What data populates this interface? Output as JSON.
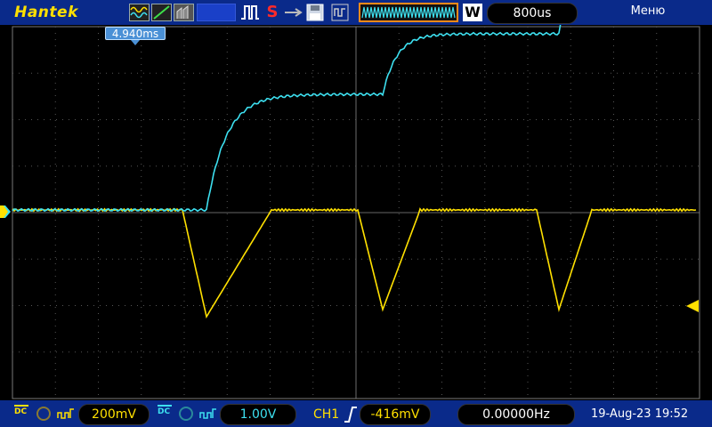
{
  "header": {
    "brand": "Hantek",
    "timebase_mode": "W",
    "timebase": "800us",
    "menu_label": "Меню",
    "run_state": "S"
  },
  "screen": {
    "trigger_time": "4.940ms",
    "trigger_level_fraction": 0.38
  },
  "footer": {
    "ch1_coupling": "DC",
    "ch1_scale": "200mV",
    "ch2_coupling": "DC",
    "ch2_scale": "1.00V",
    "trigger_source": "CH1",
    "trigger_level": "-416mV",
    "frequency": "0.00000Hz",
    "datetime": "19-Aug-23 19:52"
  },
  "colors": {
    "ch1": "#ffe000",
    "ch2": "#3de0f0",
    "bar": "#0a2a8a",
    "accent": "#ff8a1a"
  },
  "icons": [
    "wave-icon",
    "slope-icon",
    "persist-icon",
    "pulse-icon",
    "usb-icon",
    "save-icon",
    "generator-icon",
    "zoom-icon"
  ]
}
